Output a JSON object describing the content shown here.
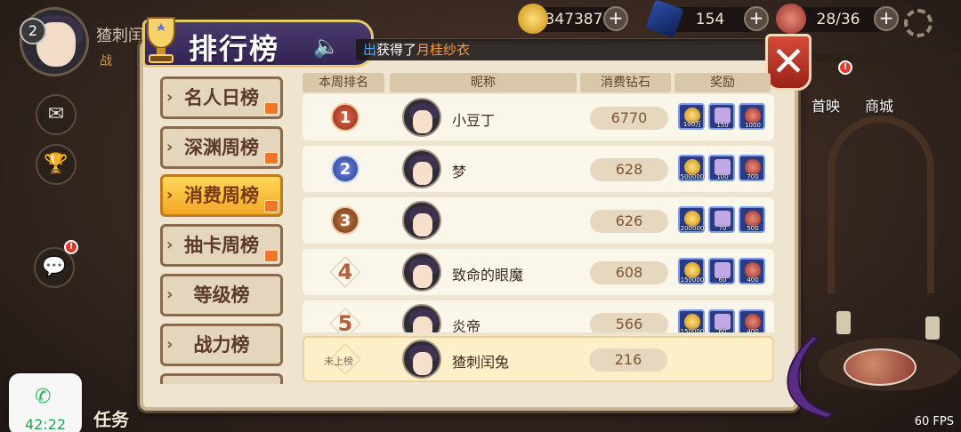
{
  "player": {
    "level": "2",
    "name": "猹刺闰",
    "power_label": "战"
  },
  "resources": [
    {
      "icon": "gold-coin-icon",
      "value": "347387"
    },
    {
      "icon": "blue-gem-icon",
      "value": "154"
    },
    {
      "icon": "meat-stamina-icon",
      "value": "28/36"
    }
  ],
  "panel": {
    "title": "排行榜",
    "ticker": {
      "who": "出",
      "text": "获得了",
      "item": "月桂纱衣"
    }
  },
  "tabs": [
    {
      "label": "名人日榜",
      "active": false,
      "gift": true
    },
    {
      "label": "深渊周榜",
      "active": false,
      "gift": true
    },
    {
      "label": "消费周榜",
      "active": true,
      "gift": true
    },
    {
      "label": "抽卡周榜",
      "active": false,
      "gift": true
    },
    {
      "label": "等级榜",
      "active": false,
      "gift": false
    },
    {
      "label": "战力榜",
      "active": false,
      "gift": false
    }
  ],
  "table": {
    "headers": [
      "本周排名",
      "昵称",
      "消费钻石",
      "奖励"
    ],
    "rows": [
      {
        "rank": "1",
        "name": "小豆丁",
        "cost": "6770",
        "rewards": [
          "100万",
          "150",
          "1000"
        ]
      },
      {
        "rank": "2",
        "name": "梦",
        "cost": "628",
        "rewards": [
          "500000",
          "100",
          "700"
        ]
      },
      {
        "rank": "3",
        "name": "",
        "cost": "626",
        "rewards": [
          "200000",
          "70",
          "500"
        ]
      },
      {
        "rank": "4",
        "name": "致命的眼魔",
        "cost": "608",
        "rewards": [
          "150000",
          "60",
          "400"
        ]
      },
      {
        "rank": "5",
        "name": "炎帝",
        "cost": "566",
        "rewards": [
          "150000",
          "60",
          "400"
        ]
      }
    ],
    "mine": {
      "rank": "未上榜",
      "name": "猹刺闰兔",
      "cost": "216"
    }
  },
  "right_menu": [
    {
      "label": "首映"
    },
    {
      "label": "商城"
    }
  ],
  "bottom": {
    "task_label": "任务",
    "call_time": "42:22",
    "fps": "60 FPS"
  },
  "colors": {
    "panel_bg": "#efe4cf",
    "active_tab": "#f3a626",
    "title_banner": "#4b3a6e",
    "close_button": "#d64a3a"
  }
}
